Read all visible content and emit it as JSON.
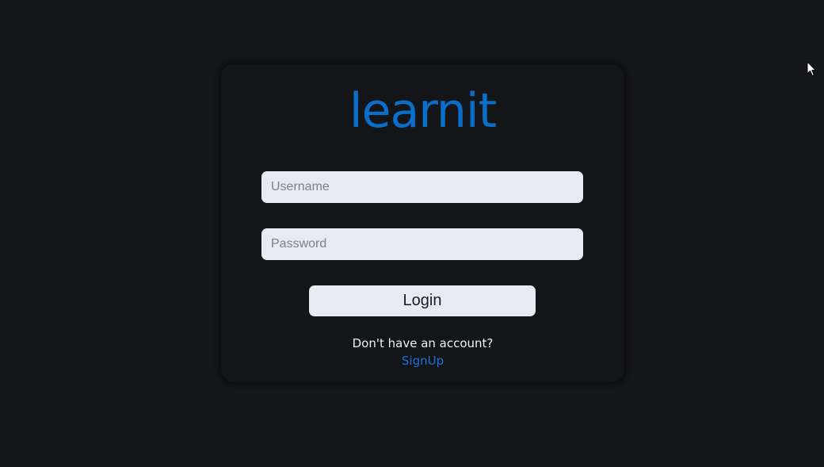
{
  "brand": {
    "logo_text": "learnit",
    "color": "#0a6fca"
  },
  "form": {
    "username_placeholder": "Username",
    "username_value": "",
    "password_placeholder": "Password",
    "password_value": "",
    "login_label": "Login"
  },
  "footer": {
    "prompt": "Don't have an account?",
    "signup_label": "SignUp",
    "link_color": "#1a73d9"
  },
  "icons": {
    "cursor": "mouse-pointer-icon"
  }
}
